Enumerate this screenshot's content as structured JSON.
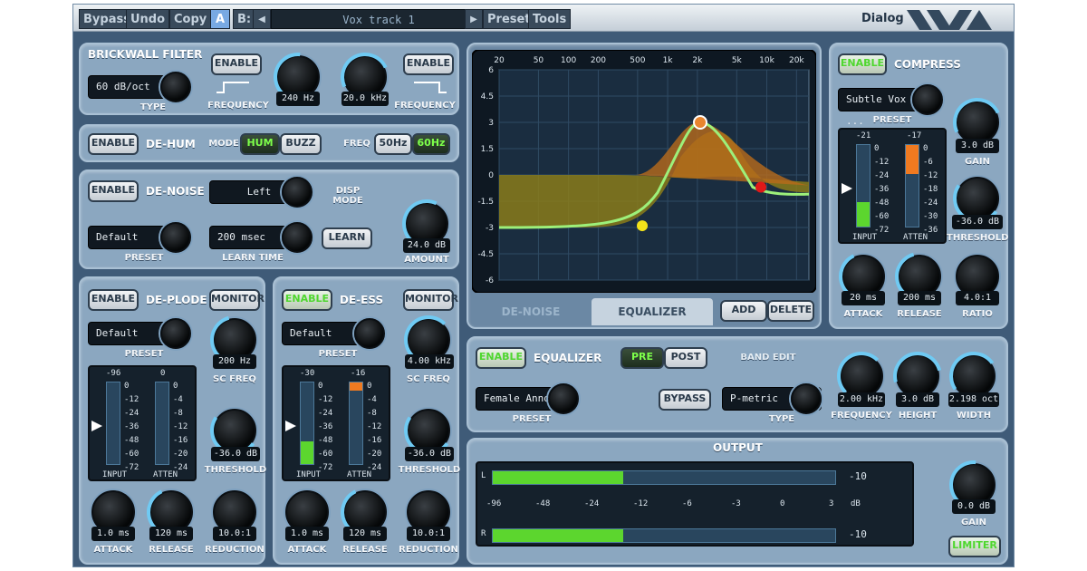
{
  "toolbar": {
    "bypass": "Bypass",
    "undo": "Undo",
    "copy": "Copy",
    "a": "A",
    "b": "B:",
    "preset_name": "Vox track 1",
    "prev": "◀",
    "next": "▶",
    "preset": "Preset",
    "tools": "Tools",
    "dialog": "Dialog"
  },
  "brickwall": {
    "title": "BRICKWALL FILTER",
    "enable_l": "ENABLE",
    "enable_r": "ENABLE",
    "type_value": "60 dB/oct",
    "type": "TYPE",
    "freq_l_label": "FREQUENCY",
    "freq_r_label": "FREQUENCY",
    "low": "240 Hz",
    "high": "20.0 kHz"
  },
  "dehum": {
    "enable": "ENABLE",
    "title": "DE-HUM",
    "mode": "MODE",
    "hum": "HUM",
    "buzz": "BUZZ",
    "freq": "FREQ",
    "f50": "50Hz",
    "f60": "60Hz"
  },
  "denoise": {
    "enable": "ENABLE",
    "title": "DE-NOISE",
    "disp_value": "Left",
    "disp": "DISP MODE",
    "preset_value": "Default",
    "preset": "PRESET",
    "learn_time_value": "200 msec",
    "learn_time": "LEARN TIME",
    "learn": "LEARN",
    "amount_value": "24.0 dB",
    "amount": "AMOUNT"
  },
  "deplode": {
    "enable": "ENABLE",
    "title": "DE-PLODE",
    "monitor": "MONITOR",
    "preset_value": "Default",
    "preset": "PRESET",
    "scfreq_value": "200 Hz",
    "scfreq": "SC FREQ",
    "in_top": "-96",
    "atten_top": "0",
    "scale": [
      "0",
      "-12",
      "-24",
      "-36",
      "-48",
      "-60",
      "-72"
    ],
    "ascale": [
      "0",
      "-4",
      "-8",
      "-12",
      "-16",
      "-20",
      "-24"
    ],
    "input": "INPUT",
    "atten": "ATTEN",
    "threshold_value": "-36.0 dB",
    "threshold": "THRESHOLD",
    "attack_value": "1.0 ms",
    "attack": "ATTACK",
    "release_value": "120 ms",
    "release": "RELEASE",
    "reduction_value": "10.0:1",
    "reduction": "REDUCTION",
    "input_level": 0.0,
    "atten_level": 0.0
  },
  "deess": {
    "enable": "ENABLE",
    "title": "DE-ESS",
    "monitor": "MONITOR",
    "preset_value": "Default",
    "preset": "PRESET",
    "scfreq_value": "4.00 kHz",
    "scfreq": "SC FREQ",
    "in_top": "-30",
    "atten_top": "-16",
    "scale": [
      "0",
      "-12",
      "-24",
      "-36",
      "-48",
      "-60",
      "-72"
    ],
    "ascale": [
      "0",
      "-4",
      "-8",
      "-12",
      "-16",
      "-20",
      "-24"
    ],
    "input": "INPUT",
    "atten": "ATTEN",
    "threshold_value": "-36.0 dB",
    "threshold": "THRESHOLD",
    "attack_value": "1.0 ms",
    "attack": "ATTACK",
    "release_value": "120 ms",
    "release": "RELEASE",
    "reduction_value": "10.0:1",
    "reduction": "REDUCTION",
    "input_level": 0.28,
    "atten_level": 0.1
  },
  "eqgraph": {
    "freqs": [
      "20",
      "50",
      "100",
      "200",
      "500",
      "1k",
      "2k",
      "5k",
      "10k",
      "20k"
    ],
    "db": [
      "6",
      "4.5",
      "3",
      "1.5",
      "0",
      "-1.5",
      "-3",
      "-4.5",
      "-6"
    ]
  },
  "tabs": {
    "denoise": "DE-NOISE",
    "equalizer": "EQUALIZER"
  },
  "eqctrl": {
    "add": "ADD",
    "delete": "DELETE",
    "enable": "ENABLE",
    "title": "EQUALIZER",
    "pre": "PRE",
    "post": "POST",
    "band_edit": "BAND EDIT",
    "preset_value": "Female Anno...",
    "preset": "PRESET",
    "bypass": "BYPASS",
    "type_value": "P-metric",
    "type": "TYPE",
    "freq_value": "2.00 kHz",
    "freq": "FREQUENCY",
    "height_value": "3.0 dB",
    "height": "HEIGHT",
    "width_value": "2.198 oct",
    "width": "WIDTH"
  },
  "compress": {
    "enable": "ENABLE",
    "title": "COMPRESS",
    "preset_value": "Subtle Vox ...",
    "preset": "PRESET",
    "gain_value": "3.0 dB",
    "gain": "GAIN",
    "in_top": "-21",
    "atten_top": "-17",
    "scale": [
      "0",
      "-12",
      "-24",
      "-36",
      "-48",
      "-60",
      "-72"
    ],
    "ascale": [
      "0",
      "-6",
      "-12",
      "-18",
      "-24",
      "-30",
      "-36"
    ],
    "input": "INPUT",
    "atten": "ATTEN",
    "threshold_value": "-36.0 dB",
    "threshold": "THRESHOLD",
    "attack_value": "20 ms",
    "attack": "ATTACK",
    "release_value": "200 ms",
    "release": "RELEASE",
    "ratio_value": "4.0:1",
    "ratio": "RATIO",
    "input_level": 0.3,
    "atten_level": 0.35
  },
  "output": {
    "title": "OUTPUT",
    "l": "L",
    "r": "R",
    "l_val": "-10",
    "r_val": "-10",
    "scale": [
      "-96",
      "-48",
      "-24",
      "-12",
      "-6",
      "-3",
      "0",
      "3"
    ],
    "db": "dB",
    "gain_value": "0.0 dB",
    "gain": "GAIN",
    "limiter": "LIMITER",
    "l_level": 0.38,
    "r_level": 0.38
  }
}
